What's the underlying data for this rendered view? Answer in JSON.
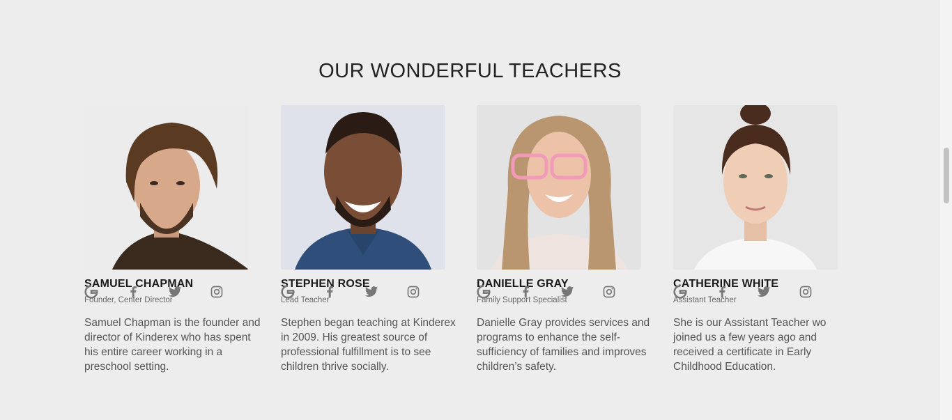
{
  "section": {
    "title": "OUR WONDERFUL TEACHERS"
  },
  "teachers": [
    {
      "name": "SAMUEL CHAPMAN",
      "role": "Founder, Center Director",
      "bio": "Samuel Chapman is the founder and director of Kinderex who has spent his entire career working in a preschool setting."
    },
    {
      "name": "STEPHEN ROSE",
      "role": "Lead Teacher",
      "bio": "Stephen began teaching at Kinderex in 2009. His greatest source of professional fulfillment is to see children thrive socially."
    },
    {
      "name": "DANIELLE GRAY",
      "role": "Family Support Specialist",
      "bio": "Danielle Gray provides services and programs to enhance the self-sufficiency of families and improves children’s safety."
    },
    {
      "name": "CATHERINE WHITE",
      "role": "Assistant Teacher",
      "bio": "She is our Assistant Teacher wo joined us a few years ago and received a certificate in Early Childhood Education."
    }
  ],
  "social_icons": [
    "google-icon",
    "facebook-icon",
    "twitter-icon",
    "instagram-icon"
  ],
  "colors": {
    "background": "#ededed",
    "icon": "#777777",
    "heading": "#222222"
  }
}
